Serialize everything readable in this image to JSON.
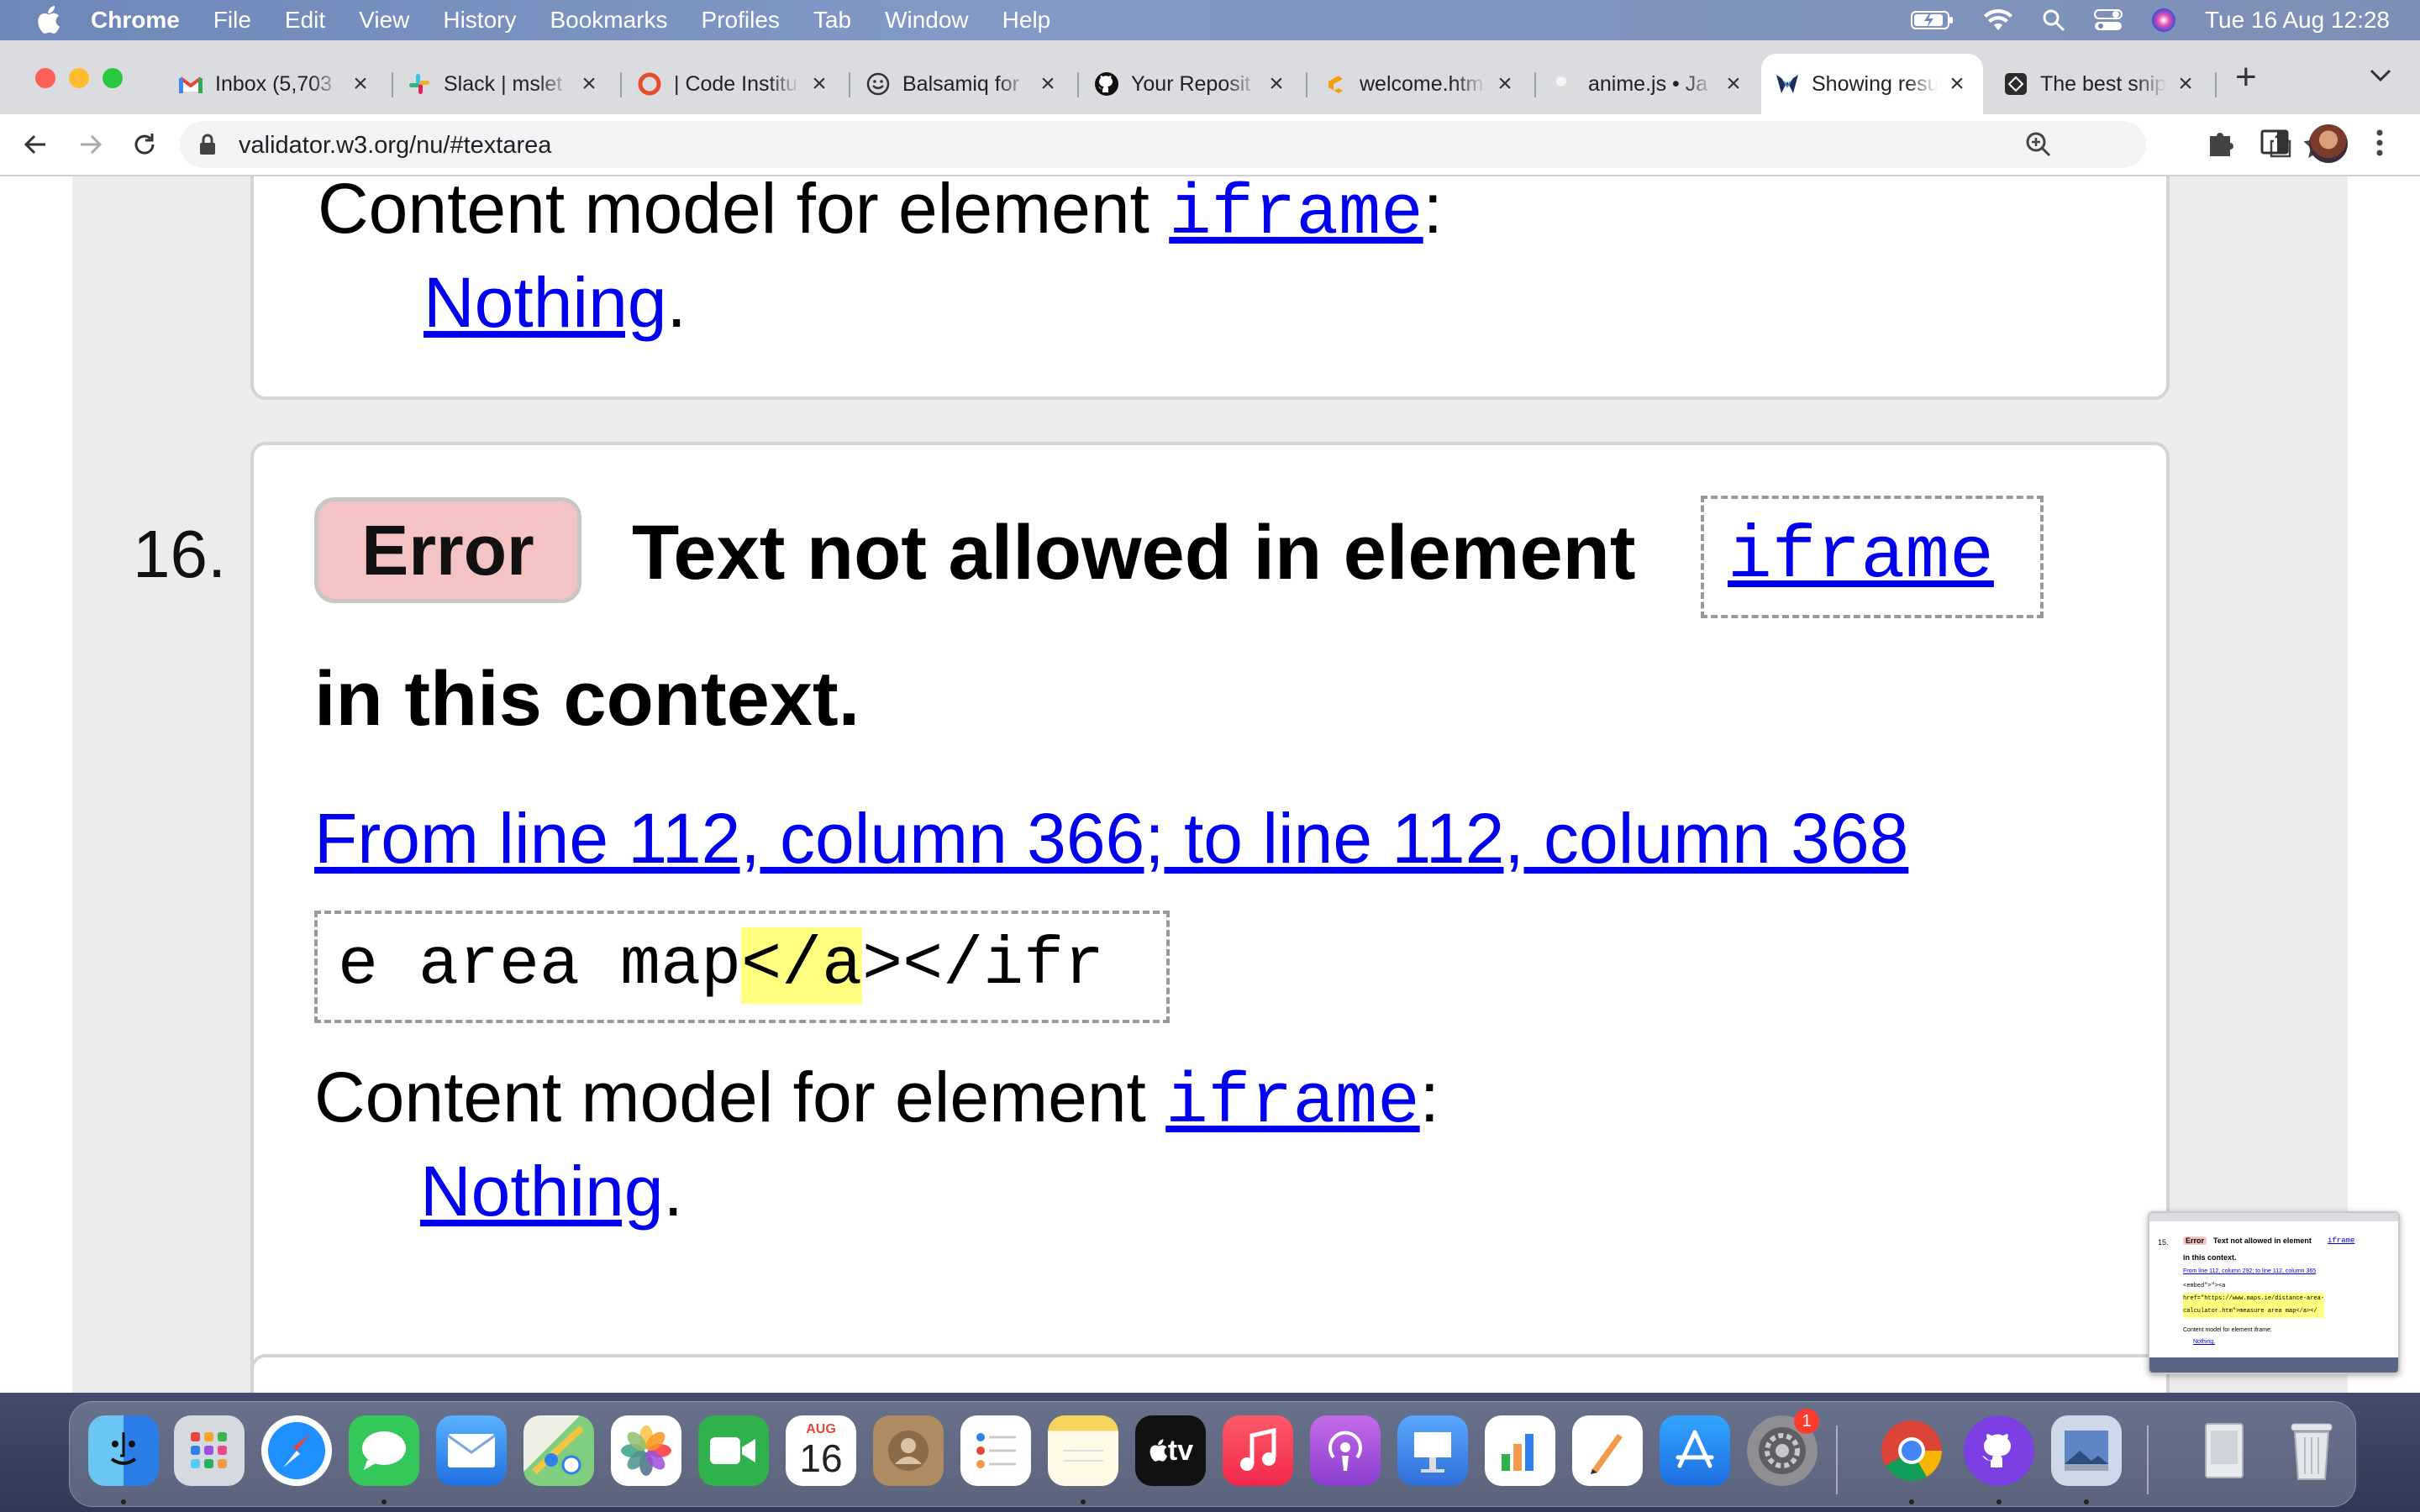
{
  "menubar": {
    "app": "Chrome",
    "items": [
      "File",
      "Edit",
      "View",
      "History",
      "Bookmarks",
      "Profiles",
      "Tab",
      "Window",
      "Help"
    ],
    "clock": "Tue 16 Aug  12:28"
  },
  "tabs": [
    {
      "label": "Inbox (5,703",
      "icon": "gmail-icon",
      "color": "#ea4335"
    },
    {
      "label": "Slack | mslet",
      "icon": "slack-icon",
      "color": "#4a154b"
    },
    {
      "label": "| Code Institu",
      "icon": "code-institute-icon",
      "color": "#e84c2a"
    },
    {
      "label": "Balsamiq for",
      "icon": "balsamiq-icon",
      "color": "#333333"
    },
    {
      "label": "Your Reposit",
      "icon": "github-icon",
      "color": "#111111"
    },
    {
      "label": "welcome.htm",
      "icon": "gitpod-icon",
      "color": "#f59e0b"
    },
    {
      "label": "anime.js • Ja",
      "icon": "anime-icon",
      "color": "#bbbbbb"
    },
    {
      "label": "Showing resu",
      "icon": "validator-icon",
      "color": "#1d2f5a",
      "active": true
    },
    {
      "label": "The best snip",
      "icon": "snippet-icon",
      "color": "#2b2b2b"
    }
  ],
  "omnibox": {
    "url": "validator.w3.org/nu/#textarea"
  },
  "page": {
    "prev": {
      "content_model_label": "Content model for element ",
      "element": "iframe",
      "colon": ":",
      "nothing": "Nothing",
      "period": "."
    },
    "message": {
      "number": "16.",
      "badge": "Error",
      "title_part1": "Text not allowed in element",
      "element": "iframe",
      "title_part2": "in this context.",
      "location": "From line 112, column 366; to line 112, column 368",
      "extract_before": "e area map",
      "extract_highlight": "</a",
      "extract_after": "></ifr",
      "content_model_label": "Content model for element ",
      "content_model_element": "iframe",
      "colon": ":",
      "nothing": "Nothing",
      "period": "."
    }
  },
  "thumbnail": {
    "number": "15.",
    "badge": "Error",
    "title": "Text not allowed in element",
    "element": "iframe",
    "context": "in this context.",
    "location": "From line 112, column 292; to line 112, column 365",
    "code_lines": [
      "<embed\">\"><a",
      "href=\"https://www.maps.ie/distance-area-",
      "calculator.htm\">measure area map</a></"
    ],
    "content_model": "Content model for element iframe:",
    "nothing": "Nothing."
  },
  "dock": {
    "calendar_month": "AUG",
    "calendar_day": "16",
    "settings_badge": "1",
    "tv_label": "tv",
    "apps": [
      {
        "name": "finder-icon",
        "color": "#2f8cf0"
      },
      {
        "name": "launchpad-icon",
        "color": "#7d8796"
      },
      {
        "name": "safari-icon",
        "color": "#1e90ff"
      },
      {
        "name": "messages-icon",
        "color": "#34c759"
      },
      {
        "name": "mail-icon",
        "color": "#3a8ef0"
      },
      {
        "name": "maps-icon",
        "color": "#6cc36c"
      },
      {
        "name": "photos-icon",
        "color": "#ffffff"
      },
      {
        "name": "facetime-icon",
        "color": "#2fb24c"
      },
      {
        "name": "calendar-icon",
        "color": "#ffffff"
      },
      {
        "name": "contacts-icon",
        "color": "#b08a60"
      },
      {
        "name": "reminders-icon",
        "color": "#ffffff"
      },
      {
        "name": "notes-icon",
        "color": "#f9e38a"
      },
      {
        "name": "appletv-icon",
        "color": "#111111"
      },
      {
        "name": "music-icon",
        "color": "#fa3b4d"
      },
      {
        "name": "podcasts-icon",
        "color": "#9b4fd6"
      },
      {
        "name": "keynote-icon",
        "color": "#2f7fe0"
      },
      {
        "name": "numbers-icon",
        "color": "#ffffff"
      },
      {
        "name": "pages-icon",
        "color": "#ffffff"
      },
      {
        "name": "appstore-icon",
        "color": "#1c8ef0"
      },
      {
        "name": "system-preferences-icon",
        "color": "#8e8e93"
      },
      {
        "name": "chrome-icon",
        "color": "#ffffff"
      },
      {
        "name": "github-desktop-icon",
        "color": "#7b3fe4"
      },
      {
        "name": "preview-icon",
        "color": "#cfd8e8"
      },
      {
        "name": "downloads-stack-icon",
        "color": "#cfd3d9"
      },
      {
        "name": "trash-icon",
        "color": "#d8dbe0"
      }
    ]
  }
}
